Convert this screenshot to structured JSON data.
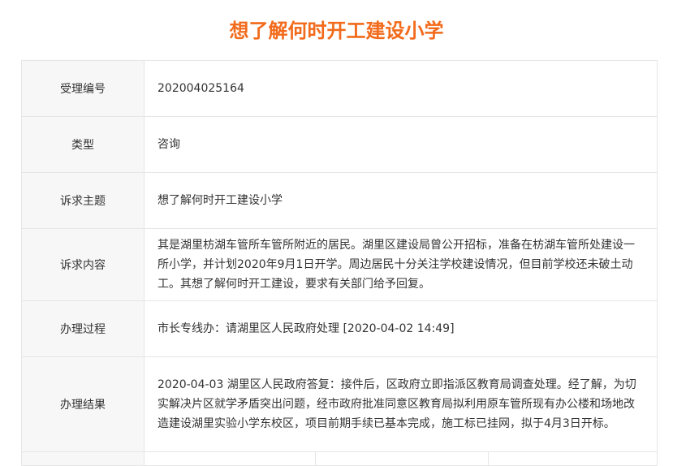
{
  "title": "想了解何时开工建设小学",
  "fields": [
    {
      "label": "受理编号",
      "value": "202004025164"
    },
    {
      "label": "类型",
      "value": "咨询"
    },
    {
      "label": "诉求主题",
      "value": "想了解何时开工建设小学"
    },
    {
      "label": "诉求内容",
      "value": "其是湖里枋湖车管所车管所附近的居民。湖里区建设局曾公开招标，准备在枋湖车管所处建设一所小学，并计划2020年9月1日开学。周边居民十分关注学校建设情况，但目前学校还未破土动工。其想了解何时开工建设，要求有关部门给予回复。"
    },
    {
      "label": "办理过程",
      "value": "市长专线办：请湖里区人民政府处理 [2020-04-02 14:49]"
    },
    {
      "label": "办理结果",
      "value": "2020-04-03 湖里区人民政府答复：接件后，区政府立即指派区教育局调查处理。经了解，为切实解决片区就学矛盾突出问题，经市政府批准同意区教育局拟利用原车管所现有办公楼和场地改造建设湖里实验小学东校区，项目前期手续已基本完成，施工标已挂网，拟于4月3日开标。"
    }
  ]
}
